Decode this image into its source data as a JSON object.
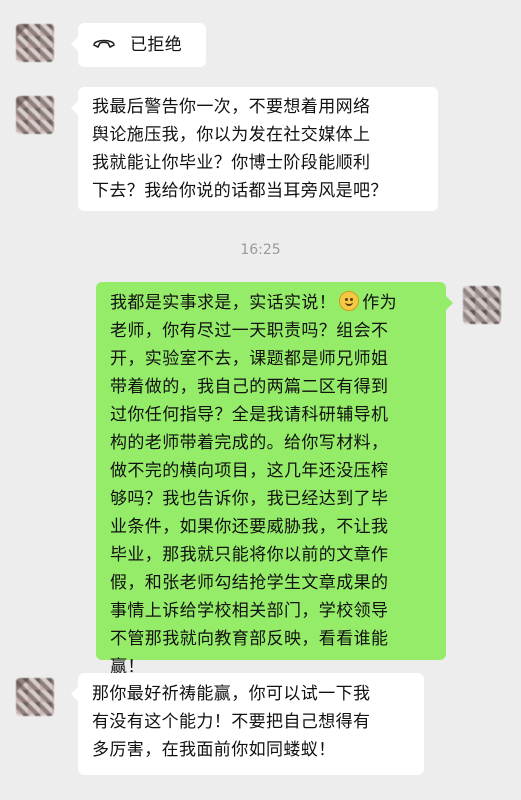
{
  "messages": {
    "call_status": "已拒绝",
    "warning": {
      "lines": [
        "我最后警告你一次，不要想着用网络",
        "舆论施压我，你以为发在社交媒体上",
        "我就能让你毕业？你博士阶段能顺利",
        "下去？我给你说的话都当耳旁风是吧？"
      ]
    },
    "timestamp": "16:25",
    "reply": {
      "line1_before_emoji": "我都是实事求是，实话实说！",
      "line1_after_emoji": "作为",
      "emoji": "smiling-face",
      "lines": [
        "老师，你有尽过一天职责吗？组会不",
        "开，实验室不去，课题都是师兄师姐",
        "带着做的，我自己的两篇二区有得到",
        "过你任何指导？全是我请科研辅导机",
        "构的老师带着完成的。给你写材料，",
        "做不完的横向项目，这几年还没压榨",
        "够吗？我也告诉你，我已经达到了毕",
        "业条件，如果你还要威胁我，不让我",
        "毕业，那我就只能将你以前的文章作",
        "假，和张老师勾结抢学生文章成果的",
        "事情上诉给学校相关部门，学校领导",
        "不管那我就向教育部反映，看看谁能",
        "赢！"
      ]
    },
    "last": {
      "lines": [
        "那你最好祈祷能赢，你可以试一下我",
        "有没有这个能力！不要把自己想得有",
        "多厉害，在我面前你如同蝼蚁！"
      ]
    }
  },
  "colors": {
    "background": "#ededed",
    "incoming_bubble": "#ffffff",
    "outgoing_bubble": "#95ec69",
    "timestamp": "#9a9a9a"
  }
}
